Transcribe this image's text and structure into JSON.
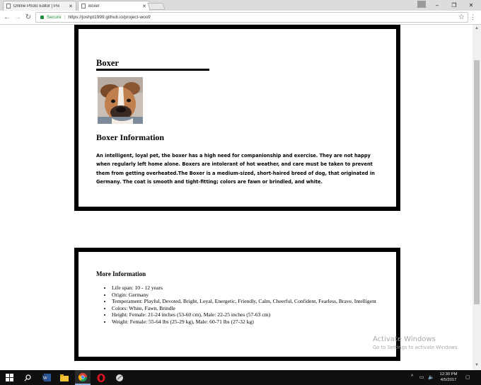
{
  "browser": {
    "tabs": [
      {
        "title": "Online Photo Editor | Pix",
        "active": false
      },
      {
        "title": "Boxer",
        "active": true
      }
    ],
    "address": {
      "secure_label": "Secure",
      "url": "https://joshpt1999.github.io/project-woof/"
    }
  },
  "page": {
    "dog_name": "Boxer",
    "photo_alt": "boxer puppy",
    "info_heading": "Boxer Information",
    "info_text": "An intelligent, loyal pet, the boxer has a high need for companionship and exercise. They are not happy when regularly left home alone. Boxers are intolerant of hot weather, and care must be taken to prevent them from getting overheated.The Boxer is a medium-sized, short-haired breed of dog, that originated in Germany. The coat is smooth and tight-fitting; colors are fawn or brindled, and white.",
    "more_heading": "More Information",
    "facts": [
      "Life span: 10 - 12 years",
      "Origin: Germany",
      "Temperament: Playful, Devoted, Bright, Loyal, Energetic, Friendly, Calm, Cheerful, Confident, Fearless, Brave, Intelligent",
      "Colors: White, Fawn, Brindle",
      "Height: Female: 21-24 inches (53-60 cm), Male: 22-25 inches (57-63 cm)",
      "Weight: Female: 55-64 lbs (25-29 kg), Male: 60-71 lbs (27-32 kg)"
    ]
  },
  "watermark": {
    "title": "Activate Windows",
    "subtitle": "Go to Settings to activate Windows."
  },
  "taskbar": {
    "apps": [
      "start-icon",
      "search-icon",
      "word-icon",
      "file-explorer-icon",
      "chrome-icon",
      "opera-icon",
      "app-icon"
    ],
    "time": "12:30 PM",
    "date": "4/5/2017"
  },
  "colors": {
    "secure_green": "#1e8e3e",
    "taskbar": "#101010",
    "card_border": "#000000"
  }
}
